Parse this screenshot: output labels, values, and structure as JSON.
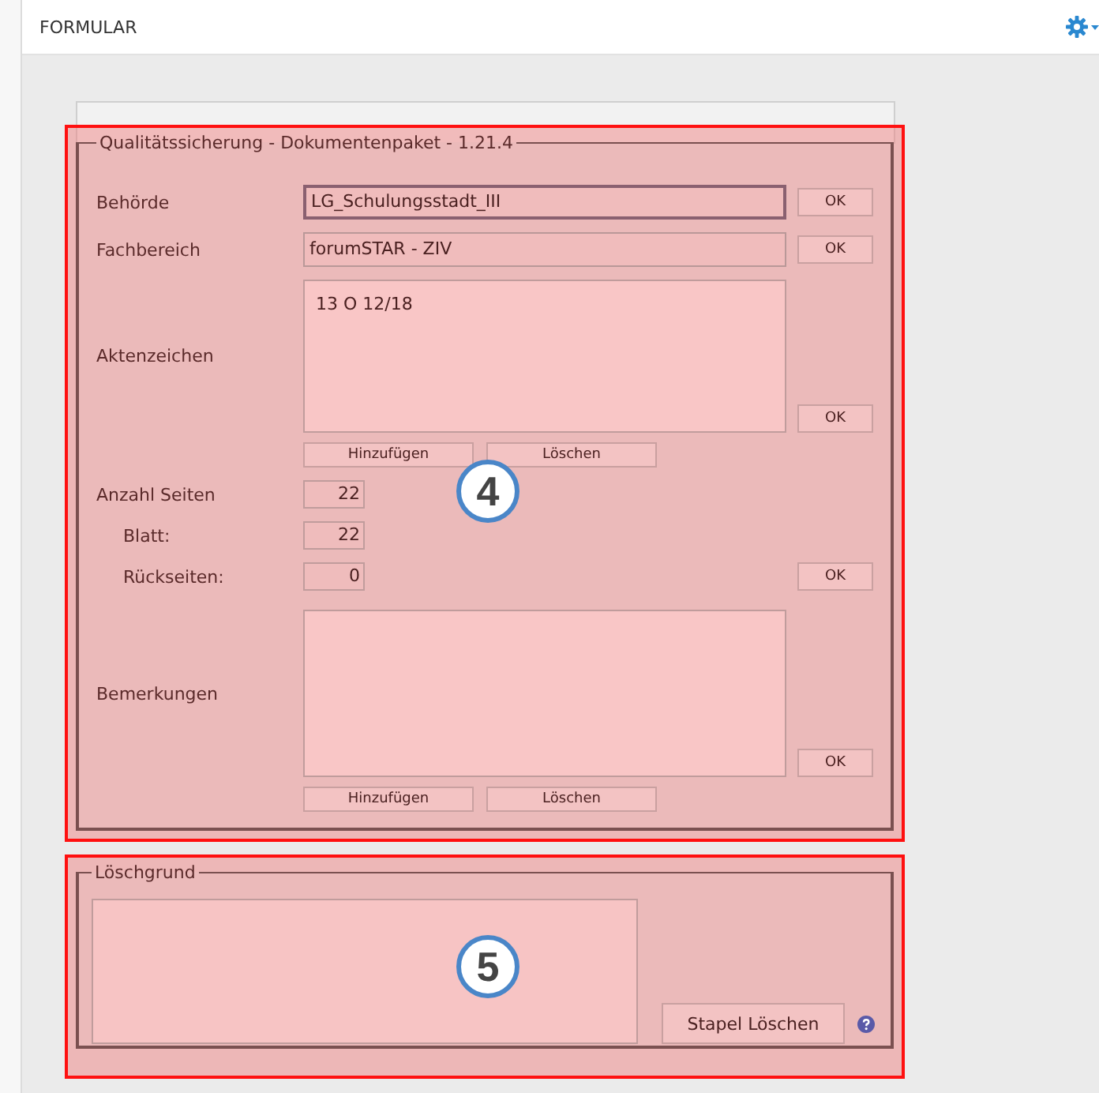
{
  "header": {
    "title": "FORMULAR"
  },
  "sections": [
    {
      "legend": "Qualitätssicherung - Dokumentenpaket - 1.21.4",
      "highlighted": true,
      "badge": "4",
      "rows": [
        {
          "kind": "input",
          "label": "Behörde",
          "value": "LG_Schulungsstadt_III",
          "focused": true,
          "ok": "OK"
        },
        {
          "kind": "input",
          "label": "Fachbereich",
          "value": "forumSTAR - ZIV",
          "focused": false,
          "ok": "OK"
        },
        {
          "kind": "list",
          "label": "Aktenzeichen",
          "items": [
            "13 O 12/18"
          ],
          "ok": "OK",
          "buttons": [
            "Hinzufügen",
            "Löschen"
          ]
        },
        {
          "kind": "number",
          "label": "Anzahl Seiten",
          "value": "22",
          "sub": false
        },
        {
          "kind": "number",
          "label": "Blatt:",
          "value": "22",
          "sub": true
        },
        {
          "kind": "number",
          "label": "Rückseiten:",
          "value": "0",
          "sub": true,
          "ok": "OK"
        },
        {
          "kind": "memo",
          "label": "Bemerkungen",
          "ok": "OK",
          "buttons": [
            "Hinzufügen",
            "Löschen"
          ]
        }
      ]
    },
    {
      "legend": "Löschgrund",
      "highlighted": true,
      "badge": "5",
      "button": "Stapel Löschen"
    }
  ]
}
